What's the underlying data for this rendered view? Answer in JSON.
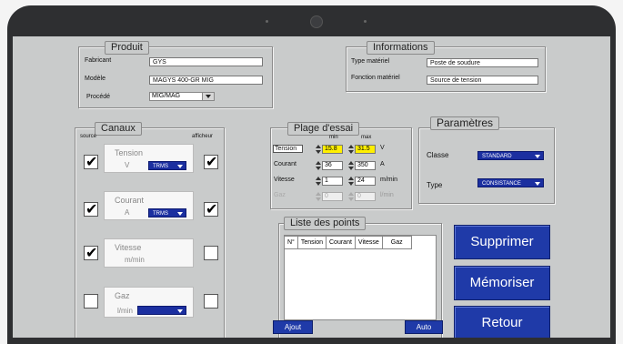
{
  "produit": {
    "legend": "Produit",
    "fabricant_label": "Fabricant",
    "fabricant_value": "GYS",
    "modele_label": "Modèle",
    "modele_value": "MAGYS 400-GR MIG",
    "procede_label": "Procédé",
    "procede_value": "MIG/MAG"
  },
  "informations": {
    "legend": "Informations",
    "type_label": "Type matériel",
    "type_value": "Poste de soudure",
    "fonction_label": "Fonction matériel",
    "fonction_value": "Source de tension"
  },
  "canaux": {
    "legend": "Canaux",
    "source_label": "source",
    "afficheur_label": "afficheur",
    "channels": [
      {
        "name": "Tension",
        "unit": "V",
        "mode": "TRMS",
        "source": true,
        "afficheur": true
      },
      {
        "name": "Courant",
        "unit": "A",
        "mode": "TRMS",
        "source": true,
        "afficheur": true
      },
      {
        "name": "Vitesse",
        "unit": "m/min",
        "mode": "",
        "source": true,
        "afficheur": false
      },
      {
        "name": "Gaz",
        "unit": "l/min",
        "mode": "",
        "source": false,
        "afficheur": false
      }
    ]
  },
  "plage": {
    "legend": "Plage d'essai",
    "min_label": "min",
    "max_label": "max",
    "rows": [
      {
        "label": "Tension",
        "min": "15.8",
        "max": "31.5",
        "unit": "V"
      },
      {
        "label": "Courant",
        "min": "36",
        "max": "350",
        "unit": "A"
      },
      {
        "label": "Vitesse",
        "min": "1",
        "max": "24",
        "unit": "m/min"
      },
      {
        "label": "Gaz",
        "min": "0",
        "max": "0",
        "unit": "l/min"
      }
    ]
  },
  "parametres": {
    "legend": "Paramètres",
    "classe_label": "Classe",
    "classe_value": "STANDARD",
    "type_label": "Type",
    "type_value": "CONSISTANCE"
  },
  "liste": {
    "legend": "Liste des points",
    "columns": [
      "N°",
      "Tension",
      "Courant",
      "Vitesse",
      "Gaz"
    ],
    "ajout_label": "Ajout",
    "auto_label": "Auto"
  },
  "actions": {
    "supprimer_label": "Supprimer",
    "memoriser_label": "Mémoriser",
    "retour_label": "Retour"
  }
}
